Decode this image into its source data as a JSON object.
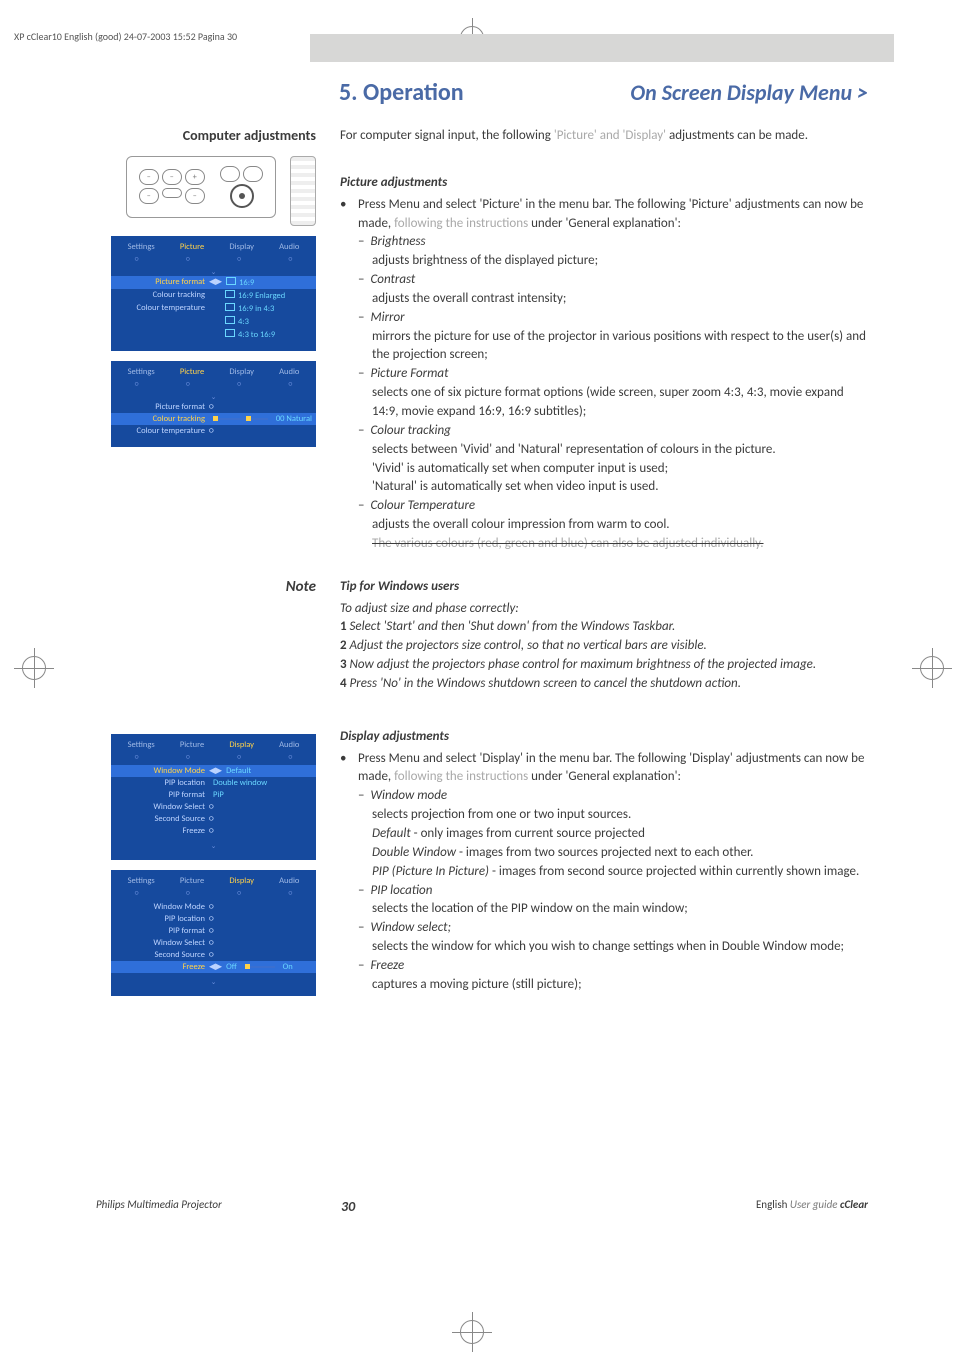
{
  "meta": {
    "header": "XP cClear10 English (good)  24-07-2003  15:52  Pagina 30"
  },
  "title": {
    "section": "5. Operation",
    "subtitle": "On Screen Display Menu >"
  },
  "side": {
    "heading": "Computer adjustments",
    "note": "Note"
  },
  "intro": {
    "pre": "For computer signal input, the following ",
    "grey": "'Picture' and 'Display'",
    "post": " adjustments can be made."
  },
  "picture": {
    "heading": "Picture adjustments",
    "bullet_pre": "Press Menu and select 'Picture' in the menu bar. The following 'Picture' adjustments can now be made, ",
    "bullet_grey": "following the instructions",
    "bullet_post": " under 'General explanation':",
    "items": [
      {
        "label": "Brightness",
        "desc": "adjusts brightness of the displayed picture;"
      },
      {
        "label": "Contrast",
        "desc": "adjusts the overall contrast intensity;"
      },
      {
        "label": "Mirror",
        "desc": "mirrors the picture for use of the projector in various positions with respect to the user(s) and the projection screen;"
      },
      {
        "label": "Picture Format",
        "desc": "selects one of six picture format options (wide screen, super zoom 4:3, 4:3, movie expand 14:9, movie expand 16:9, 16:9 subtitles);"
      },
      {
        "label": "Colour tracking",
        "desc": "selects between 'Vivid' and 'Natural' representation of colours in the picture.",
        "extra": [
          "'Vivid' is automatically set when computer input is used;",
          "'Natural' is automatically set when video input is used."
        ]
      },
      {
        "label": "Colour Temperature",
        "desc": "adjusts the overall colour impression from warm to cool.",
        "strike": "The various colours (red, green and blue) can also be adjusted individually."
      }
    ]
  },
  "tip": {
    "heading": "Tip for Windows users",
    "intro": "To adjust size and phase correctly:",
    "steps": [
      "Select 'Start' and then 'Shut down' from the Windows Taskbar.",
      "Adjust the projectors size control, so that no vertical bars are visible.",
      "Now adjust the projectors phase control for maximum brightness of the projected image.",
      "Press 'No' in the Windows shutdown screen to cancel the shutdown action."
    ]
  },
  "display": {
    "heading": "Display adjustments",
    "bullet_pre": "Press Menu and select 'Display' in the menu bar. The following 'Display' adjustments can now be made, ",
    "bullet_grey": "following the instructions",
    "bullet_post": " under 'General explanation':",
    "items": [
      {
        "label": "Window mode",
        "desc": "selects projection from one or two input sources.",
        "lines": [
          {
            "em": "Default",
            "rest": " - only images from current source projected"
          },
          {
            "em": "Double Window",
            "rest": " - images from two sources projected next to each other."
          },
          {
            "em": "PIP (Picture In Picture)",
            "rest": " - images from second source projected within currently shown image."
          }
        ]
      },
      {
        "label": "PIP location",
        "desc": "selects the location of the PIP window on the main window;"
      },
      {
        "label": "Window select;",
        "desc": "selects the window for which you wish to change settings when in Double Window mode;"
      },
      {
        "label": "Freeze",
        "desc": "captures a moving picture (still picture);"
      }
    ]
  },
  "osd": {
    "tabs": [
      "Settings",
      "Picture",
      "Display",
      "Audio"
    ],
    "picture_menu": {
      "rows": [
        {
          "lbl": "Picture format",
          "vals": [
            "16:9",
            "16:9 Enlarged",
            "16:9 in 4:3",
            "4:3",
            "4:3 to 16:9"
          ],
          "hl": true
        },
        {
          "lbl": "Colour tracking"
        },
        {
          "lbl": "Colour temperature"
        }
      ]
    },
    "picture_menu2": {
      "rows": [
        {
          "lbl": "Picture format"
        },
        {
          "lbl": "Colour tracking",
          "slider": true,
          "right": "00 Natural",
          "hl": true
        },
        {
          "lbl": "Colour temperature"
        }
      ]
    },
    "display_menu": {
      "rows": [
        {
          "lbl": "Window Mode",
          "vals": [
            "Default",
            "Double window",
            "PiP"
          ],
          "hl": true
        },
        {
          "lbl": "PIP location"
        },
        {
          "lbl": "PIP format"
        },
        {
          "lbl": "Window Select"
        },
        {
          "lbl": "Second Source"
        },
        {
          "lbl": "Freeze"
        }
      ]
    },
    "display_menu2": {
      "rows": [
        {
          "lbl": "Window Mode"
        },
        {
          "lbl": "PIP location"
        },
        {
          "lbl": "PIP format"
        },
        {
          "lbl": "Window Select"
        },
        {
          "lbl": "Second Source"
        },
        {
          "lbl": "Freeze",
          "toggle": [
            "Off",
            "On"
          ],
          "hl": true
        }
      ]
    }
  },
  "footer": {
    "left": "Philips Multimedia Projector",
    "page": "30",
    "right_plain": "English ",
    "right_ug": "User guide  ",
    "right_brand": "cClear"
  }
}
